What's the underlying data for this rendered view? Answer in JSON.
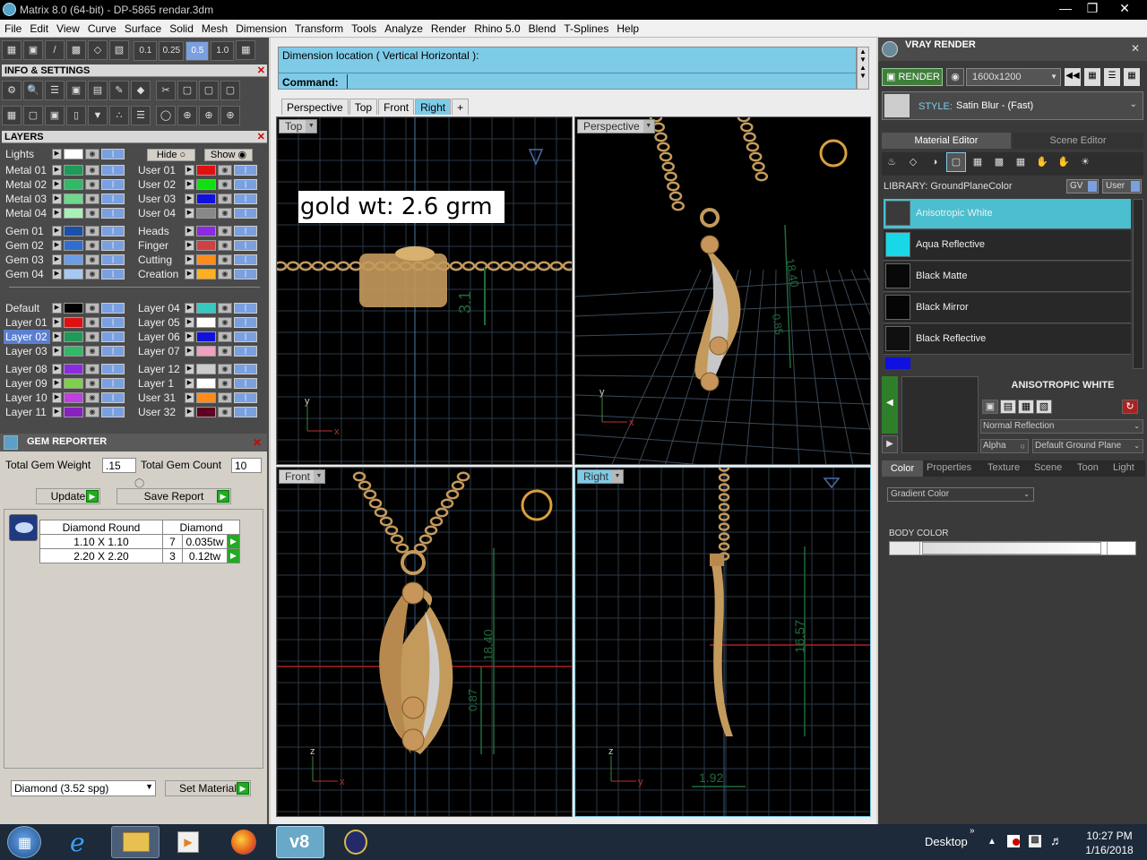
{
  "window": {
    "title": "Matrix 8.0 (64-bit) - DP-5865 rendar.3dm"
  },
  "menu": [
    "File",
    "Edit",
    "View",
    "Curve",
    "Surface",
    "Solid",
    "Mesh",
    "Dimension",
    "Transform",
    "Tools",
    "Analyze",
    "Render",
    "Rhino 5.0",
    "Blend",
    "T-Splines",
    "Help"
  ],
  "toolbar": {
    "scales": [
      "0.1",
      "0.25",
      "0.5",
      "1.0"
    ]
  },
  "info_panel": {
    "title": "INFO & SETTINGS"
  },
  "layers_panel": {
    "title": "LAYERS",
    "lights_label": "Lights",
    "hide_label": "Hide",
    "show_label": "Show",
    "left_col": [
      {
        "name": "Metal 01",
        "color": "#1f9a58"
      },
      {
        "name": "Metal 02",
        "color": "#33b866"
      },
      {
        "name": "Metal 03",
        "color": "#6ed98a"
      },
      {
        "name": "Metal 04",
        "color": "#a8f0b8"
      },
      {
        "name": "Gem 01",
        "color": "#1b4fa8"
      },
      {
        "name": "Gem 02",
        "color": "#2f6ed0"
      },
      {
        "name": "Gem 03",
        "color": "#6a9ee8"
      },
      {
        "name": "Gem 04",
        "color": "#a8c8f4"
      },
      {
        "name": "Default",
        "color": "#000000"
      },
      {
        "name": "Layer 01",
        "color": "#e01010"
      },
      {
        "name": "Layer 02",
        "color": "#1f9a58"
      },
      {
        "name": "Layer 03",
        "color": "#33b866"
      },
      {
        "name": "Layer 08",
        "color": "#8a2be2"
      },
      {
        "name": "Layer 09",
        "color": "#7ed04a"
      },
      {
        "name": "Layer 10",
        "color": "#c040e0"
      },
      {
        "name": "Layer 11",
        "color": "#8a20c0"
      }
    ],
    "right_col": [
      {
        "name": "User 01",
        "color": "#e01010"
      },
      {
        "name": "User 02",
        "color": "#10e010"
      },
      {
        "name": "User 03",
        "color": "#1010e0"
      },
      {
        "name": "User 04",
        "color": "#888888"
      },
      {
        "name": "Heads",
        "color": "#8a2be2"
      },
      {
        "name": "Finger",
        "color": "#d04040"
      },
      {
        "name": "Cutting",
        "color": "#ff8c1a"
      },
      {
        "name": "Creation",
        "color": "#ffb020"
      },
      {
        "name": "Layer 04",
        "color": "#38c8c0"
      },
      {
        "name": "Layer 05",
        "color": "#ffffff"
      },
      {
        "name": "Layer 06",
        "color": "#1010e0"
      },
      {
        "name": "Layer 07",
        "color": "#f0a0c0"
      },
      {
        "name": "Layer 12",
        "color": "#cccccc"
      },
      {
        "name": "Layer 1",
        "color": "#ffffff"
      },
      {
        "name": "User 31",
        "color": "#ff8c1a"
      },
      {
        "name": "User 32",
        "color": "#600020"
      }
    ]
  },
  "gem_reporter": {
    "title": "GEM REPORTER",
    "total_weight_label": "Total Gem Weight",
    "total_weight": ".15",
    "total_count_label": "Total Gem Count",
    "total_count": "10",
    "update_label": "Update",
    "save_label": "Save Report",
    "headers": [
      "Diamond Round",
      "Diamond"
    ],
    "rows": [
      {
        "size": "1.10 X 1.10",
        "count": "7",
        "weight": "0.035tw"
      },
      {
        "size": "2.20 X 2.20",
        "count": "3",
        "weight": "0.12tw"
      }
    ],
    "material_select": "Diamond    (3.52 spg)",
    "set_material_label": "Set Material"
  },
  "command": {
    "prompt": "Dimension location ( Vertical  Horizontal ):",
    "label": "Command:"
  },
  "view_tabs": [
    "Perspective",
    "Top",
    "Front",
    "Right"
  ],
  "viewports": {
    "top": {
      "label": "Top",
      "annotation": "gold wt: 2.6 grm",
      "dim": "3.1"
    },
    "perspective": {
      "label": "Perspective",
      "dims": [
        "18.40",
        "0.85"
      ]
    },
    "front": {
      "label": "Front",
      "dims": [
        "18.40",
        "0.87"
      ]
    },
    "right": {
      "label": "Right",
      "dims": [
        "16.57",
        "1.92"
      ]
    }
  },
  "vray": {
    "title": "VRAY RENDER",
    "render_label": "RENDER",
    "resolution": "1600x1200",
    "style_label": "STYLE:",
    "style_value": "Satin Blur - (Fast)",
    "tabs": [
      "Material Editor",
      "Scene Editor"
    ],
    "library_label": "LIBRARY: GroundPlaneColor",
    "gv_label": "GV",
    "user_label": "User",
    "materials": [
      {
        "name": "Anisotropic White",
        "color": "#3a3a3a",
        "selected": true
      },
      {
        "name": "Aqua Reflective",
        "color": "#18d8e8",
        "selected": false
      },
      {
        "name": "Black Matte",
        "color": "#080808",
        "selected": false
      },
      {
        "name": "Black Mirror",
        "color": "#050505",
        "selected": false
      },
      {
        "name": "Black Reflective",
        "color": "#101010",
        "selected": false
      }
    ],
    "material_title": "ANISOTROPIC WHITE",
    "reflection_select": "Normal Reflection",
    "alpha_label": "Alpha",
    "ground_select": "Default Ground Plane",
    "prop_tabs": [
      "Color",
      "Properties",
      "Texture",
      "Scene",
      "Toon",
      "Light"
    ],
    "gradient_select": "Gradient Color",
    "body_color_label": "BODY COLOR"
  },
  "taskbar": {
    "desktop_label": "Desktop",
    "time": "10:27 PM",
    "date": "1/16/2018"
  },
  "colors": {
    "accent": "#7ecbe8",
    "grid": "#2a3a48",
    "metal": "#c49a5c",
    "dim": "#1f6b3a"
  }
}
